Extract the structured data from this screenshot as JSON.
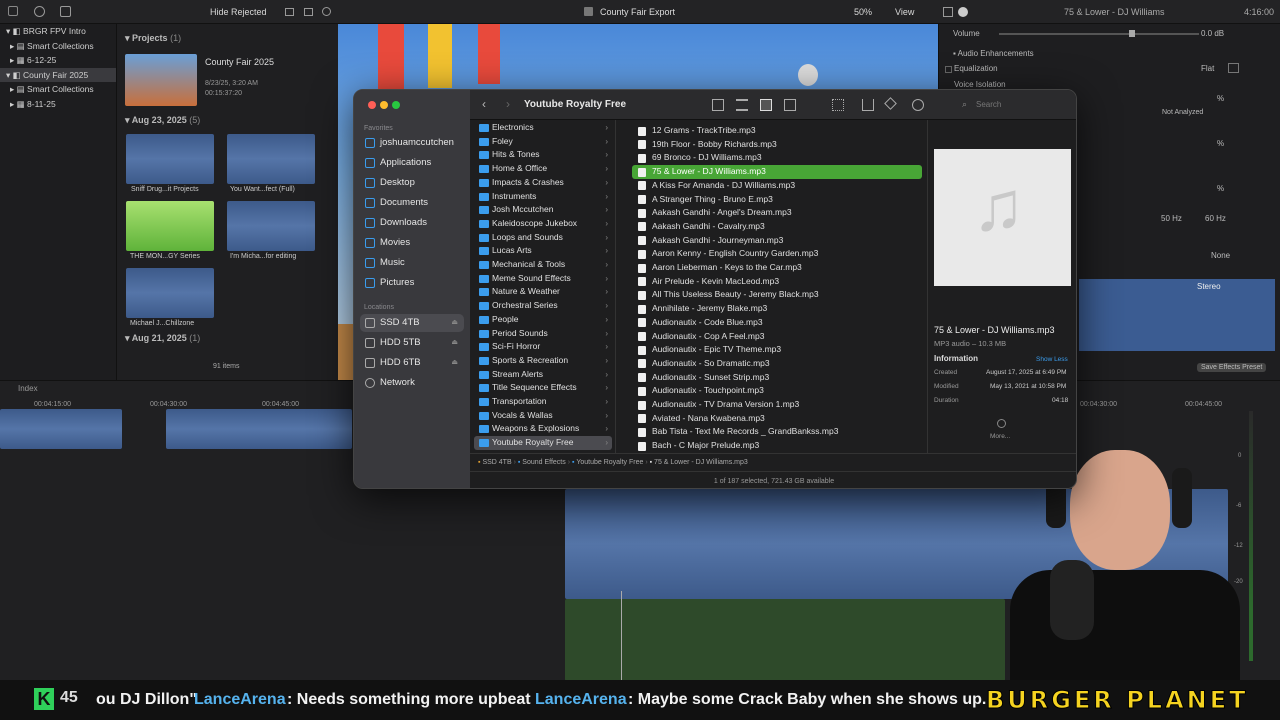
{
  "fcp": {
    "topbar": {
      "hide_rejected": "Hide Rejected",
      "project_name": "County Fair Export",
      "zoom": "50%",
      "view": "View",
      "inspector_title": "75 & Lower - DJ Williams",
      "timecode": "4:16:00"
    },
    "library": [
      {
        "label": "BRGR FPV Intro"
      },
      {
        "label": "Smart Collections"
      },
      {
        "label": "6-12-25"
      },
      {
        "label": "County Fair 2025"
      },
      {
        "label": "Smart Collections"
      },
      {
        "label": "8-11-25"
      }
    ],
    "browser": {
      "projects_header": "Projects",
      "projects_count": "(1)",
      "project_title": "County Fair 2025",
      "project_date": "8/23/25, 3:20 AM",
      "project_duration": "00:15:37:20",
      "group1_header": "Aug 23, 2025",
      "group1_count": "(5)",
      "clips": [
        "Sniff Drug...it Projects",
        "You Want...fect (Full)",
        "THE MON...GY Series",
        "I'm Micha...for editing",
        "Michael J...Chillzone"
      ],
      "group2_header": "Aug 21, 2025",
      "group2_count": "(1)",
      "items_count": "91 items"
    },
    "inspector": {
      "volume_label": "Volume",
      "volume_value": "0.0 dB",
      "audio_enh": "Audio Enhancements",
      "equalization": "Equalization",
      "eq_value": "Flat",
      "voice_isolation": "Voice Isolation",
      "not_analyzed": "Not Analyzed",
      "pct1": "%",
      "pct2": "%",
      "pct3": "%",
      "hz1": "50 Hz",
      "hz2": "60 Hz",
      "none": "None",
      "stereo": "Stereo",
      "save_preset": "Save Effects Preset"
    },
    "timeline": {
      "index_label": "Index",
      "tc1": "00:04:15:00",
      "tc2": "00:04:30:00",
      "tc3": "00:04:45:00",
      "tc4": "00:04:30:00",
      "tc5": "00:04:45:00",
      "meter_labels": [
        "0",
        "-6",
        "-12",
        "-20"
      ]
    }
  },
  "finder": {
    "title": "Youtube Royalty Free",
    "search_placeholder": "Search",
    "sidebar": {
      "favorites_label": "Favorites",
      "favorites": [
        "joshuamccutchen",
        "Applications",
        "Desktop",
        "Documents",
        "Downloads",
        "Movies",
        "Music",
        "Pictures"
      ],
      "locations_label": "Locations",
      "locations": [
        "SSD 4TB",
        "HDD 5TB",
        "HDD 6TB",
        "Network"
      ]
    },
    "folders": [
      "Electronics",
      "Foley",
      "Hits & Tones",
      "Home & Office",
      "Impacts & Crashes",
      "Instruments",
      "Josh Mccutchen",
      "Kaleidoscope Jukebox",
      "Loops and Sounds",
      "Lucas Arts",
      "Mechanical & Tools",
      "Meme Sound Effects",
      "Nature & Weather",
      "Orchestral Series",
      "People",
      "Period Sounds",
      "Sci-Fi Horror",
      "Sports & Recreation",
      "Stream Alerts",
      "Title Sequence Effects",
      "Transportation",
      "Vocals & Wallas",
      "Weapons & Explosions",
      "Youtube Royalty Free"
    ],
    "files": [
      "12 Grams - TrackTribe.mp3",
      "19th Floor - Bobby Richards.mp3",
      "69 Bronco - DJ Williams.mp3",
      "75 & Lower - DJ Williams.mp3",
      "A Kiss For Amanda - DJ Williams.mp3",
      "A Stranger Thing - Bruno E.mp3",
      "Aakash Gandhi - Angel's Dream.mp3",
      "Aakash Gandhi - Cavalry.mp3",
      "Aakash Gandhi - Journeyman.mp3",
      "Aaron Kenny - English Country Garden.mp3",
      "Aaron Lieberman - Keys to the Car.mp3",
      "Air Prelude - Kevin MacLeod.mp3",
      "All This Useless Beauty - Jeremy Black.mp3",
      "Annihilate - Jeremy Blake.mp3",
      "Audionautix - Code Blue.mp3",
      "Audionautix - Cop A Feel.mp3",
      "Audionautix - Epic TV Theme.mp3",
      "Audionautix - So Dramatic.mp3",
      "Audionautix - Sunset Strip.mp3",
      "Audionautix - Touchpoint.mp3",
      "Audionautix - TV Drama Version 1.mp3",
      "Aviated - Nana Kwabena.mp3",
      "Bab Tista - Text Me Records _ GrandBankss.mp3",
      "Bach - C Major Prelude.mp3"
    ],
    "preview": {
      "name": "75 & Lower - DJ Williams.mp3",
      "kind": "MP3 audio – 10.3 MB",
      "info_label": "Information",
      "show_less": "Show Less",
      "created_label": "Created",
      "created_value": "August 17, 2025 at 6:49 PM",
      "modified_label": "Modified",
      "modified_value": "May 13, 2021 at 10:58 PM",
      "duration_label": "Duration",
      "duration_value": "04:18",
      "more": "More..."
    },
    "path": [
      "SSD 4TB",
      "Sound Effects",
      "Youtube Royalty Free",
      "75 & Lower - DJ Williams.mp3"
    ],
    "status": "1 of 187 selected, 721.43 GB available"
  },
  "chat": {
    "badge_num": "45",
    "fragment": "ou DJ Dillon\"",
    "user1": "LanceArena",
    "msg1": ": Needs something more upbeat",
    "user2": "LanceArena",
    "msg2": ": Maybe some Crack Baby when she shows up.",
    "logo": "BURGER PLANET"
  },
  "colors": {
    "selection_green": "#48a636",
    "folder_blue": "#3b9ded",
    "chat_user": "#56b3ee",
    "logo_yellow": "#f5d320"
  }
}
